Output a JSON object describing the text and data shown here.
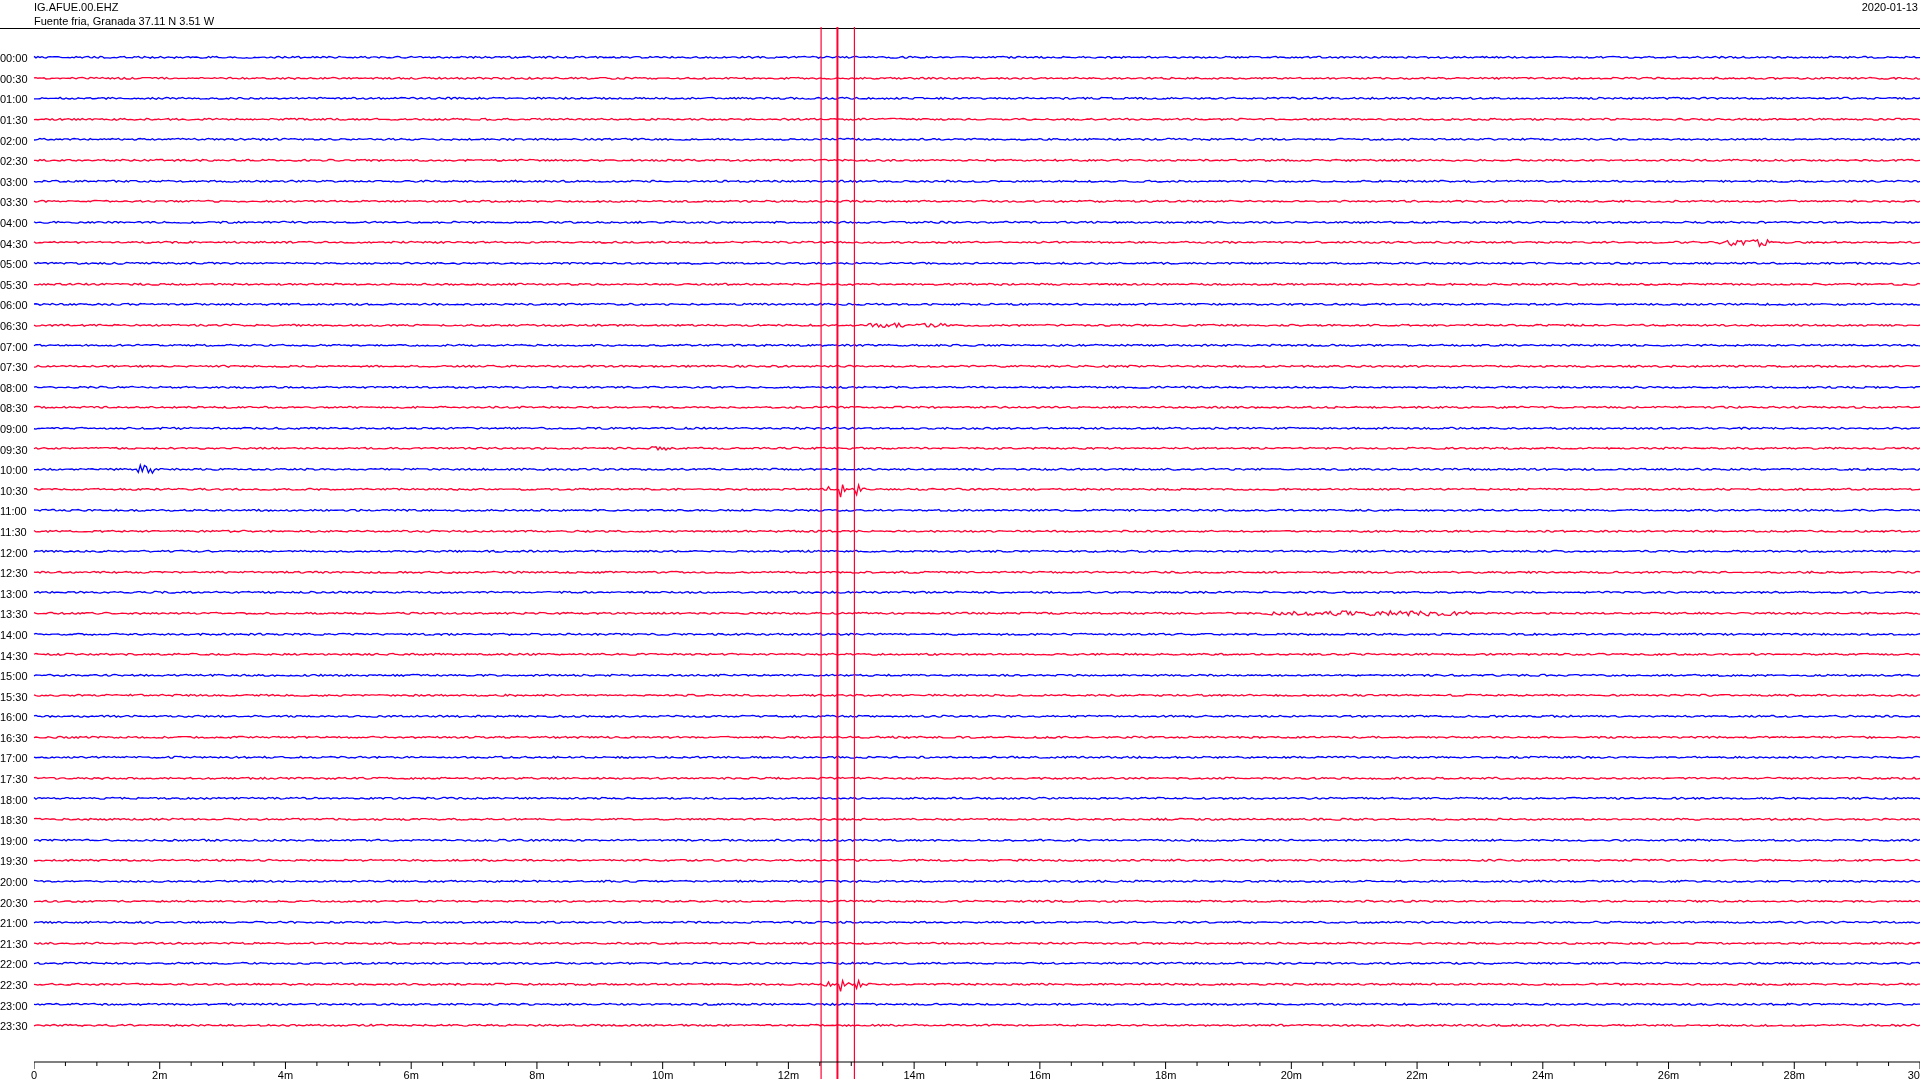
{
  "header": {
    "station": "IG.AFUE.00.EHZ",
    "location": "Fuente fria, Granada  37.11 N 3.51 W",
    "date": "2020-01-13"
  },
  "rows": [
    {
      "time": "00:00",
      "color": "#0000ff"
    },
    {
      "time": "00:30",
      "color": "#ff0033"
    },
    {
      "time": "01:00",
      "color": "#0000ff"
    },
    {
      "time": "01:30",
      "color": "#ff0033"
    },
    {
      "time": "02:00",
      "color": "#0000ff"
    },
    {
      "time": "02:30",
      "color": "#ff0033"
    },
    {
      "time": "03:00",
      "color": "#0000ff"
    },
    {
      "time": "03:30",
      "color": "#ff0033"
    },
    {
      "time": "04:00",
      "color": "#0000ff"
    },
    {
      "time": "04:30",
      "color": "#ff0033"
    },
    {
      "time": "05:00",
      "color": "#0000ff"
    },
    {
      "time": "05:30",
      "color": "#ff0033"
    },
    {
      "time": "06:00",
      "color": "#0000ff"
    },
    {
      "time": "06:30",
      "color": "#ff0033"
    },
    {
      "time": "07:00",
      "color": "#0000ff"
    },
    {
      "time": "07:30",
      "color": "#ff0033"
    },
    {
      "time": "08:00",
      "color": "#0000ff"
    },
    {
      "time": "08:30",
      "color": "#ff0033"
    },
    {
      "time": "09:00",
      "color": "#0000ff"
    },
    {
      "time": "09:30",
      "color": "#ff0033"
    },
    {
      "time": "10:00",
      "color": "#0000ff"
    },
    {
      "time": "10:30",
      "color": "#ff0033"
    },
    {
      "time": "11:00",
      "color": "#0000ff"
    },
    {
      "time": "11:30",
      "color": "#ff0033"
    },
    {
      "time": "12:00",
      "color": "#0000ff"
    },
    {
      "time": "12:30",
      "color": "#ff0033"
    },
    {
      "time": "13:00",
      "color": "#0000ff"
    },
    {
      "time": "13:30",
      "color": "#ff0033"
    },
    {
      "time": "14:00",
      "color": "#0000ff"
    },
    {
      "time": "14:30",
      "color": "#ff0033"
    },
    {
      "time": "15:00",
      "color": "#0000ff"
    },
    {
      "time": "15:30",
      "color": "#ff0033"
    },
    {
      "time": "16:00",
      "color": "#0000ff"
    },
    {
      "time": "16:30",
      "color": "#ff0033"
    },
    {
      "time": "17:00",
      "color": "#0000ff"
    },
    {
      "time": "17:30",
      "color": "#ff0033"
    },
    {
      "time": "18:00",
      "color": "#0000ff"
    },
    {
      "time": "18:30",
      "color": "#ff0033"
    },
    {
      "time": "19:00",
      "color": "#0000ff"
    },
    {
      "time": "19:30",
      "color": "#ff0033"
    },
    {
      "time": "20:00",
      "color": "#0000ff"
    },
    {
      "time": "20:30",
      "color": "#ff0033"
    },
    {
      "time": "21:00",
      "color": "#0000ff"
    },
    {
      "time": "21:30",
      "color": "#ff0033"
    },
    {
      "time": "22:00",
      "color": "#0000ff"
    },
    {
      "time": "22:30",
      "color": "#ff0033"
    },
    {
      "time": "23:00",
      "color": "#0000ff"
    },
    {
      "time": "23:30",
      "color": "#ff0033"
    }
  ],
  "x_axis": {
    "labels": [
      "0",
      "2m",
      "4m",
      "6m",
      "8m",
      "10m",
      "12m",
      "14m",
      "16m",
      "18m",
      "20m",
      "22m",
      "24m",
      "26m",
      "28m",
      "30"
    ]
  }
}
